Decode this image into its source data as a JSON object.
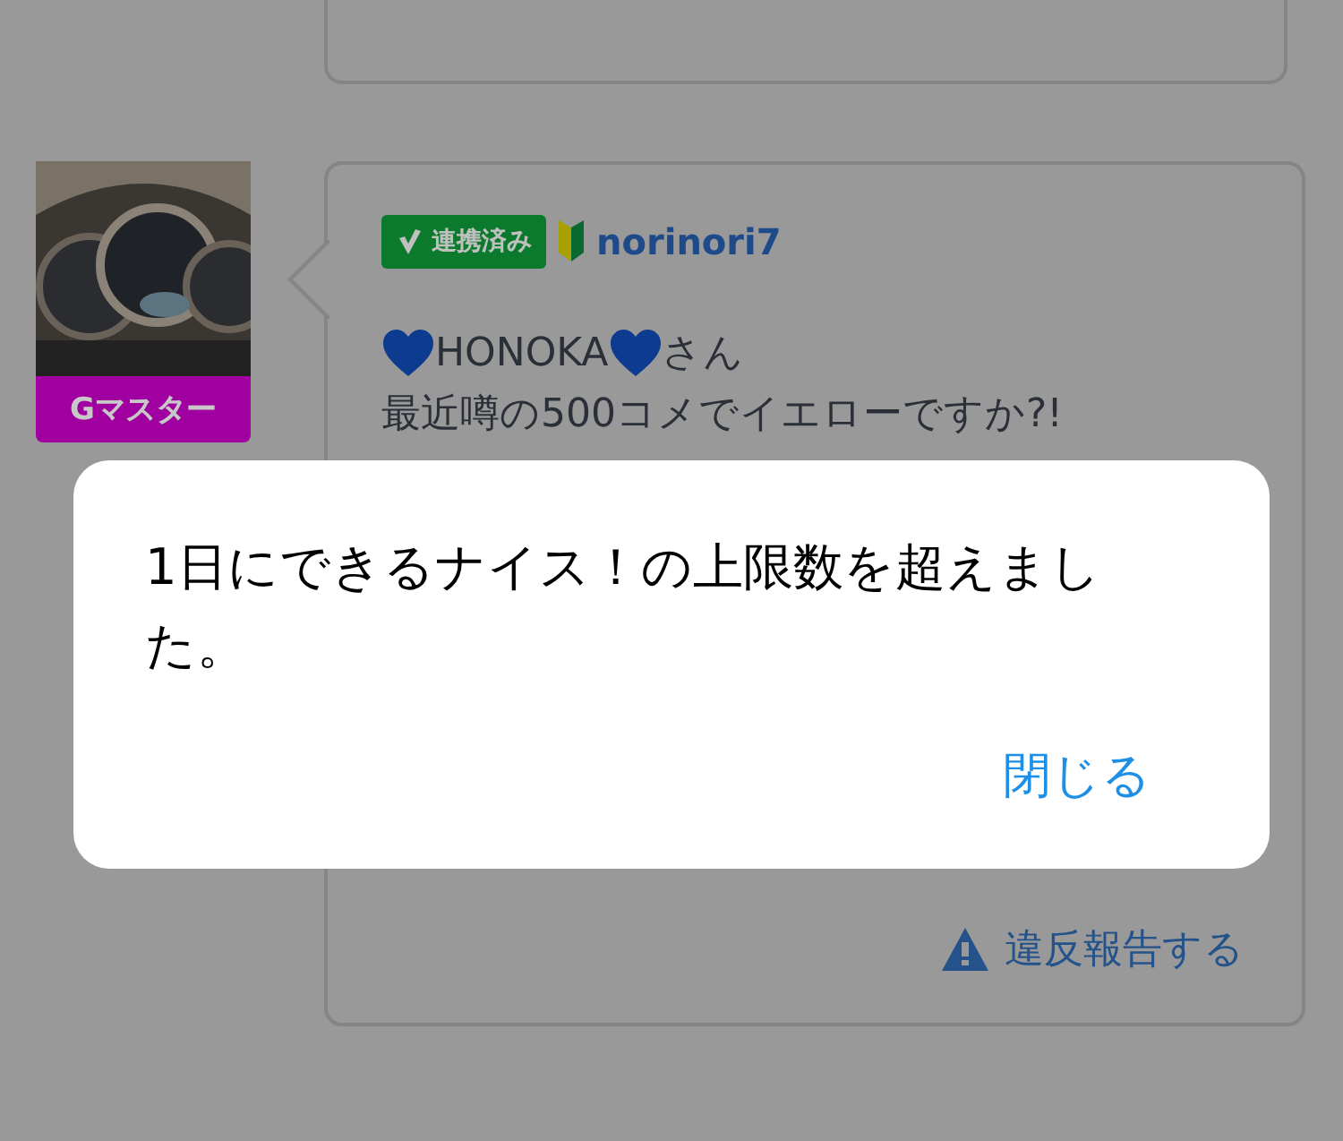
{
  "post": {
    "avatar": {
      "rank": "Gマスター"
    },
    "badge": "連携済み",
    "username": "norinori7",
    "greeting": {
      "name": "HONOKA",
      "suffix": "さん"
    },
    "line": "最近噂の500コメでイエローですか?!",
    "report": "違反報告する"
  },
  "dialog": {
    "message": "1日にできるナイス！の上限数を超えました。",
    "button": "閉じる"
  }
}
